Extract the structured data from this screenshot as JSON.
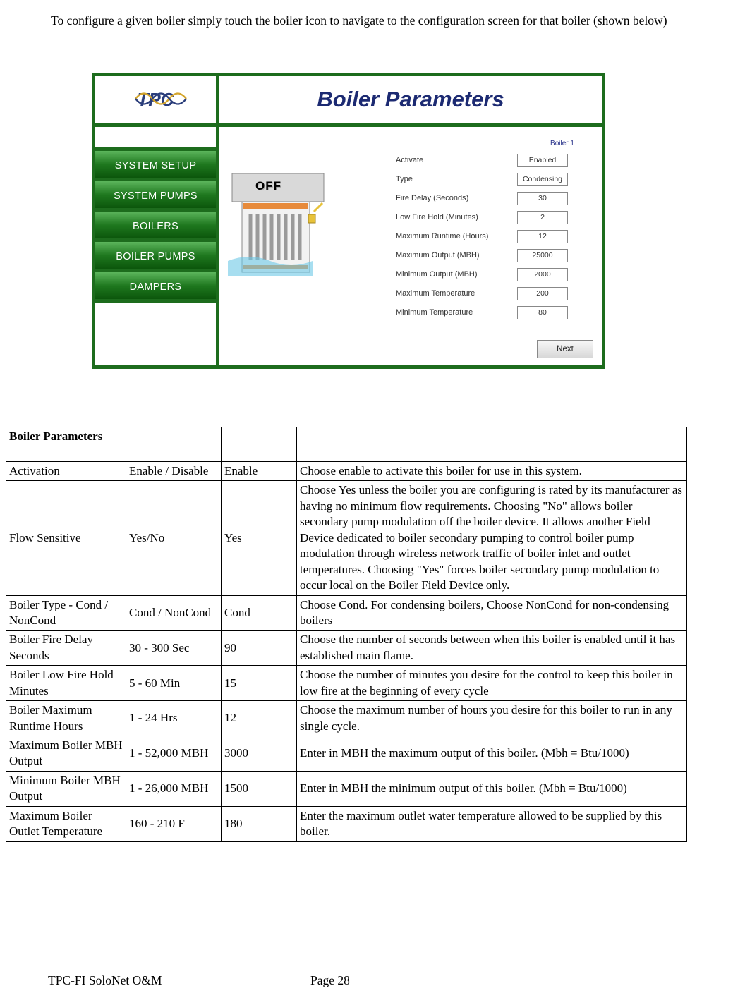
{
  "intro": "To configure a given boiler simply touch the boiler icon to navigate to the configuration screen for that boiler (shown below)",
  "hmi": {
    "logo_text_1": "T",
    "logo_text_2": "PC",
    "title": "Boiler Parameters",
    "nav": [
      "SYSTEM SETUP",
      "SYSTEM PUMPS",
      "BOILERS",
      "BOILER PUMPS",
      "DAMPERS"
    ],
    "off": "OFF",
    "col_head": "Boiler 1",
    "params": [
      {
        "label": "Activate",
        "value": "Enabled"
      },
      {
        "label": "Type",
        "value": "Condensing"
      },
      {
        "label": "Fire Delay (Seconds)",
        "value": "30"
      },
      {
        "label": "Low Fire Hold (Minutes)",
        "value": "2"
      },
      {
        "label": "Maximum Runtime (Hours)",
        "value": "12"
      },
      {
        "label": "Maximum Output (MBH)",
        "value": "25000"
      },
      {
        "label": "Minimum Output (MBH)",
        "value": "2000"
      },
      {
        "label": "Maximum Temperature",
        "value": "200"
      },
      {
        "label": "Minimum Temperature",
        "value": "80"
      }
    ],
    "next": "Next"
  },
  "spec": {
    "title": "Boiler Parameters",
    "rows": [
      {
        "c0": "Activation",
        "c1": "Enable / Disable",
        "c2": "Enable",
        "c3": "Choose enable to activate this boiler for use in this system."
      },
      {
        "c0": "Flow Sensitive",
        "c1": "Yes/No",
        "c2": "Yes",
        "c3": "Choose Yes unless the boiler you are configuring is rated by its manufacturer as having no minimum flow requirements.  Choosing \"No\" allows boiler secondary pump modulation off the boiler device.  It allows another Field Device dedicated to boiler secondary pumping to control boiler pump modulation through wireless network traffic of boiler inlet and outlet temperatures.  Choosing \"Yes\" forces boiler secondary pump modulation to occur local on the Boiler Field Device only."
      },
      {
        "c0": "Boiler Type - Cond / NonCond",
        "c1": "Cond / NonCond",
        "c2": "Cond",
        "c3": "Choose Cond. For condensing boilers, Choose NonCond for non-condensing boilers"
      },
      {
        "c0": "Boiler Fire Delay Seconds",
        "c1": "30 - 300 Sec",
        "c2": "90",
        "c3": "Choose the number of seconds between when this boiler is enabled until it has established main flame."
      },
      {
        "c0": "Boiler Low Fire Hold Minutes",
        "c1": "5 - 60 Min",
        "c2": "15",
        "c3": "Choose the number of minutes you desire for the control to keep this boiler in low fire at the beginning of every cycle"
      },
      {
        "c0": "Boiler Maximum Runtime Hours",
        "c1": "1 - 24 Hrs",
        "c2": "12",
        "c3": "Choose the maximum number of hours you desire for this boiler to run in any single cycle."
      },
      {
        "c0": "Maximum Boiler MBH Output",
        "c1": "1 - 52,000 MBH",
        "c2": "3000",
        "c3": "Enter in MBH the maximum output of this boiler.  (Mbh = Btu/1000)"
      },
      {
        "c0": "Minimum Boiler MBH Output",
        "c1": "1 - 26,000 MBH",
        "c2": "1500",
        "c3": "Enter in MBH the minimum output of this boiler. (Mbh = Btu/1000)"
      },
      {
        "c0": "Maximum Boiler Outlet Temperature",
        "c1": "160 - 210 F",
        "c2": "180",
        "c3": "Enter the maximum outlet water temperature allowed to be supplied by this boiler."
      }
    ]
  },
  "footer": {
    "left": "TPC-FI SoloNet O&M",
    "center": "Page 28"
  }
}
